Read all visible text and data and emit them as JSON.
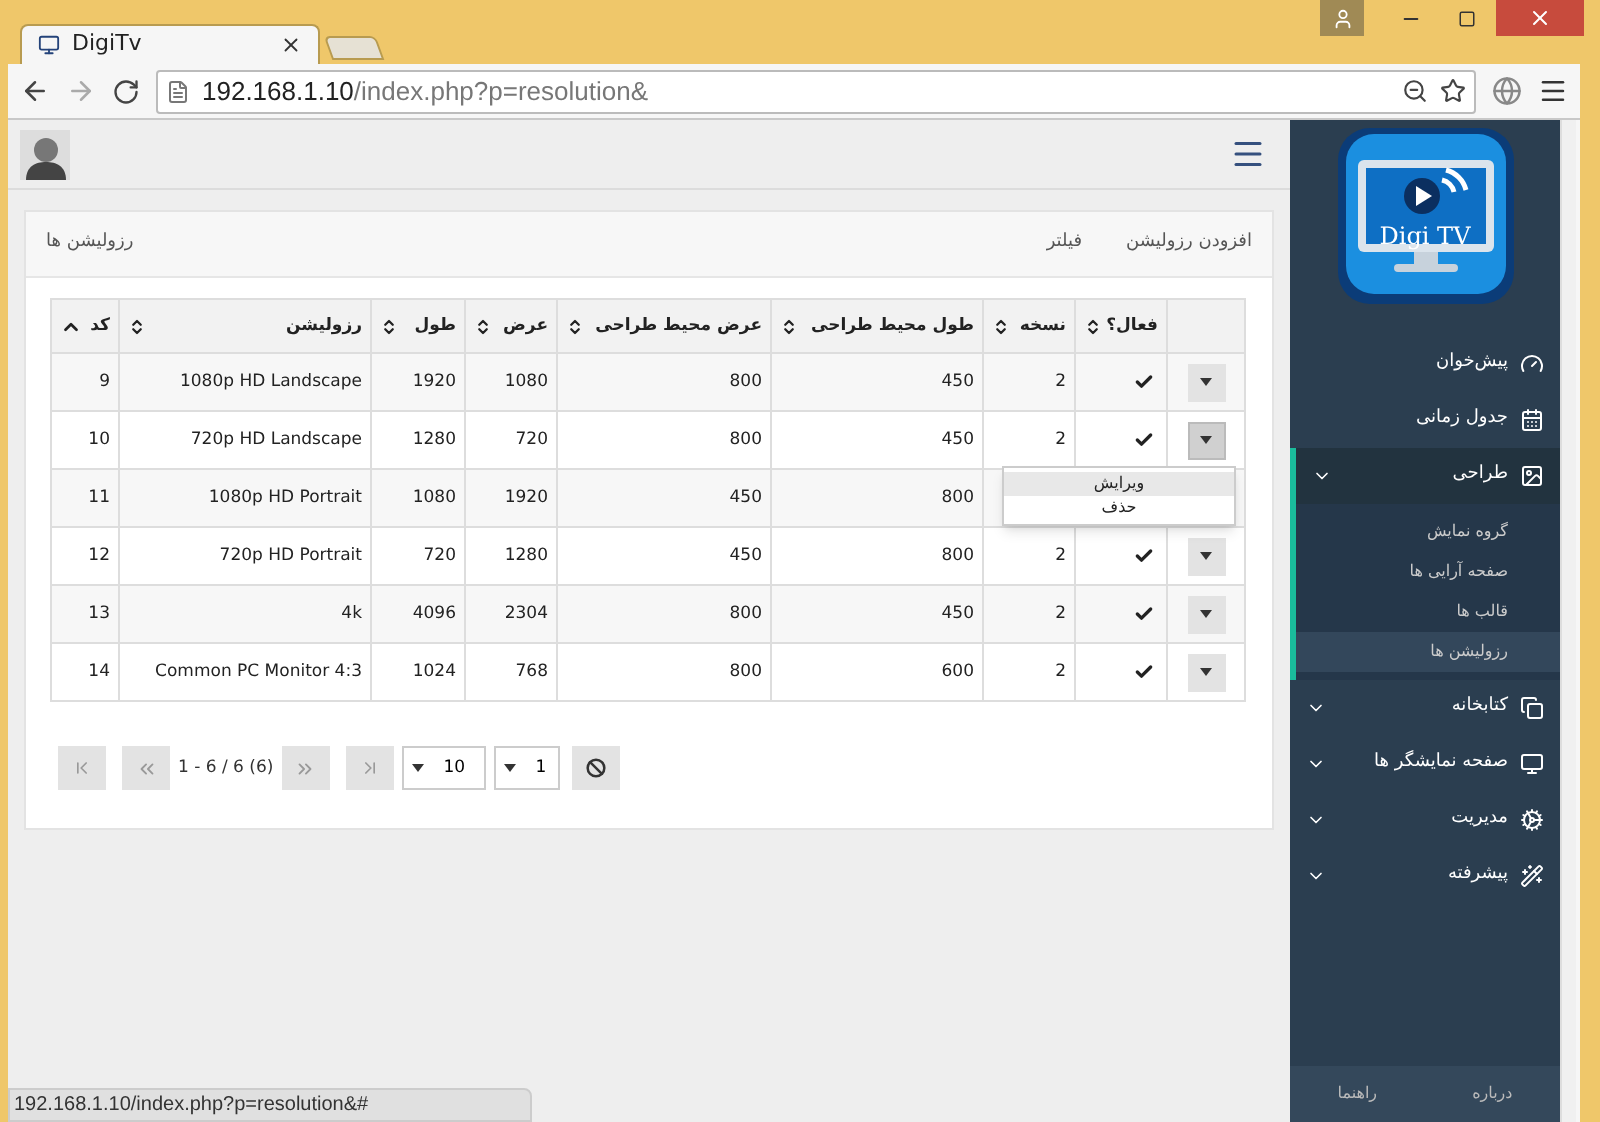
{
  "browser": {
    "tab_title": "DigiTv",
    "url_host": "192.168.1.10",
    "url_path": "/index.php?p=resolution&"
  },
  "panel": {
    "title": "رزولیشن ها",
    "links": [
      "افزودن رزولیشن",
      "فیلتر"
    ]
  },
  "table": {
    "columns": [
      {
        "kind": "actions"
      },
      {
        "kind": "sortable",
        "label": "فعال؟",
        "sorted": false
      },
      {
        "kind": "sortable",
        "label": "نسخه",
        "sorted": false
      },
      {
        "kind": "sortable",
        "label": "طول محیط طراحی",
        "sorted": false
      },
      {
        "kind": "sortable",
        "label": "عرض محیط طراحی",
        "sorted": false
      },
      {
        "kind": "sortable",
        "label": "عرض",
        "sorted": false
      },
      {
        "kind": "sortable",
        "label": "طول",
        "sorted": false
      },
      {
        "kind": "sortable",
        "label": "رزولیشن",
        "sorted": false
      },
      {
        "kind": "sortable",
        "label": "کد",
        "sorted": true
      }
    ],
    "rows": [
      {
        "cells": [
          {
            "kind": "menu",
            "menu_open": false
          },
          {
            "kind": "check",
            "active": true
          },
          {
            "kind": "text",
            "text": "2"
          },
          {
            "kind": "text",
            "text": "450"
          },
          {
            "kind": "text",
            "text": "800"
          },
          {
            "kind": "text",
            "text": "1080"
          },
          {
            "kind": "text",
            "text": "1920"
          },
          {
            "kind": "text",
            "text": "1080p HD Landscape"
          },
          {
            "kind": "text",
            "text": "9"
          }
        ]
      },
      {
        "cells": [
          {
            "kind": "menu",
            "menu_open": true
          },
          {
            "kind": "check",
            "active": true
          },
          {
            "kind": "text",
            "text": "2"
          },
          {
            "kind": "text",
            "text": "450"
          },
          {
            "kind": "text",
            "text": "800"
          },
          {
            "kind": "text",
            "text": "720"
          },
          {
            "kind": "text",
            "text": "1280"
          },
          {
            "kind": "text",
            "text": "720p HD Landscape"
          },
          {
            "kind": "text",
            "text": "10"
          }
        ]
      },
      {
        "cells": [
          {
            "kind": "covered"
          },
          {
            "kind": "covered"
          },
          {
            "kind": "covered"
          },
          {
            "kind": "text",
            "text": "800"
          },
          {
            "kind": "text",
            "text": "450"
          },
          {
            "kind": "text",
            "text": "1920"
          },
          {
            "kind": "text",
            "text": "1080"
          },
          {
            "kind": "text",
            "text": "1080p HD Portrait"
          },
          {
            "kind": "text",
            "text": "11"
          }
        ]
      },
      {
        "cells": [
          {
            "kind": "menu",
            "menu_open": false
          },
          {
            "kind": "check",
            "active": true
          },
          {
            "kind": "text",
            "text": "2"
          },
          {
            "kind": "text",
            "text": "800"
          },
          {
            "kind": "text",
            "text": "450"
          },
          {
            "kind": "text",
            "text": "1280"
          },
          {
            "kind": "text",
            "text": "720"
          },
          {
            "kind": "text",
            "text": "720p HD Portrait"
          },
          {
            "kind": "text",
            "text": "12"
          }
        ]
      },
      {
        "cells": [
          {
            "kind": "menu",
            "menu_open": false
          },
          {
            "kind": "check",
            "active": true
          },
          {
            "kind": "text",
            "text": "2"
          },
          {
            "kind": "text",
            "text": "450"
          },
          {
            "kind": "text",
            "text": "800"
          },
          {
            "kind": "text",
            "text": "2304"
          },
          {
            "kind": "text",
            "text": "4096"
          },
          {
            "kind": "text",
            "text": "4k"
          },
          {
            "kind": "text",
            "text": "13"
          }
        ]
      },
      {
        "cells": [
          {
            "kind": "menu",
            "menu_open": false
          },
          {
            "kind": "check",
            "active": true
          },
          {
            "kind": "text",
            "text": "2"
          },
          {
            "kind": "text",
            "text": "600"
          },
          {
            "kind": "text",
            "text": "800"
          },
          {
            "kind": "text",
            "text": "768"
          },
          {
            "kind": "text",
            "text": "1024"
          },
          {
            "kind": "text",
            "text": "Common PC Monitor 4:3"
          },
          {
            "kind": "text",
            "text": "14"
          }
        ]
      }
    ],
    "row_menu": [
      {
        "label": "ویرایش",
        "selected": true
      },
      {
        "label": "حذف",
        "selected": false
      }
    ]
  },
  "pagination": {
    "summary": "1 - 6 / 6 (6)",
    "page_size": "10",
    "page": "1"
  },
  "sidebar": {
    "logo_text": "Digi TV",
    "items": [
      {
        "label": "پیش‌خوان",
        "has_children": false,
        "expanded": false
      },
      {
        "label": "جدول زمانی",
        "has_children": false,
        "expanded": false
      },
      {
        "label": "طراحی",
        "has_children": true,
        "expanded": true,
        "children": [
          {
            "label": "گروه نمایش",
            "selected": false
          },
          {
            "label": "صفحه آرایی ها",
            "selected": false
          },
          {
            "label": "قالب ها",
            "selected": false
          },
          {
            "label": "رزولیشن ها",
            "selected": true
          }
        ]
      },
      {
        "label": "کتابخانه",
        "has_children": true,
        "expanded": false
      },
      {
        "label": "صفحه نمایشگر ها",
        "has_children": true,
        "expanded": false
      },
      {
        "label": "مدیریت",
        "has_children": true,
        "expanded": false
      },
      {
        "label": "پیشرفته",
        "has_children": true,
        "expanded": false
      }
    ],
    "footer": [
      "درباره",
      "راهنما"
    ]
  },
  "status_bar": "192.168.1.10/index.php?p=resolution&#"
}
